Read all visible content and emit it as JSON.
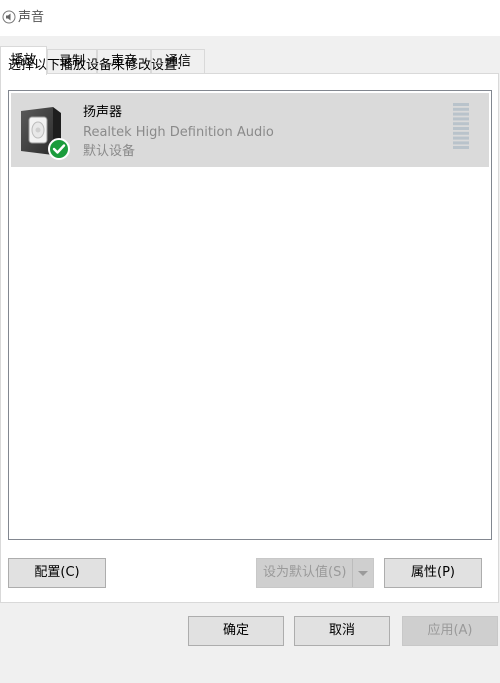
{
  "window": {
    "title": "声音",
    "icon": "speaker-icon"
  },
  "tabs": [
    {
      "label": "播放",
      "active": true
    },
    {
      "label": "录制",
      "active": false
    },
    {
      "label": "声音",
      "active": false
    },
    {
      "label": "通信",
      "active": false
    }
  ],
  "playback": {
    "instruction": "选择以下播放设备来修改设置:",
    "devices": [
      {
        "name": "扬声器",
        "description": "Realtek High Definition Audio",
        "status": "默认设备",
        "icon": "speaker-device-icon",
        "badge": "default-check-icon",
        "level": 0
      }
    ]
  },
  "buttons": {
    "configure": "配置(C)",
    "set_default": "设为默认值(S)",
    "properties": "属性(P)",
    "ok": "确定",
    "cancel": "取消",
    "apply": "应用(A)"
  },
  "colors": {
    "selection": "#dadada",
    "badge_green": "#1a9c3c",
    "disabled_text": "#9a9a9a"
  }
}
